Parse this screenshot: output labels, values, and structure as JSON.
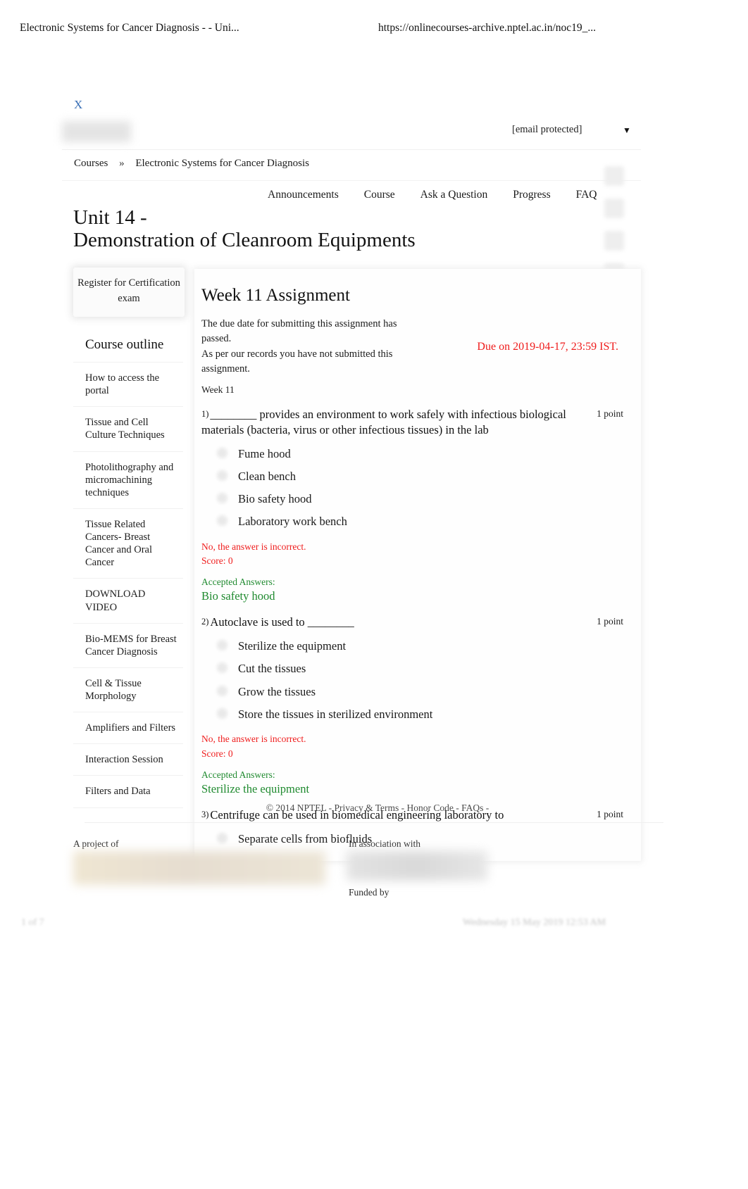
{
  "print_header": {
    "title": "Electronic Systems for Cancer Diagnosis - - Uni...",
    "url": "https://onlinecourses-archive.nptel.ac.in/noc19_..."
  },
  "print_footer": {
    "left": "1 of 7",
    "right": "Wednesday 15 May 2019 12:53 AM"
  },
  "topbar": {
    "close_label": "X",
    "account_email": "[email protected]",
    "account_caret": "▼"
  },
  "breadcrumb": {
    "root": "Courses",
    "separator": "»",
    "current": "Electronic Systems for Cancer Diagnosis"
  },
  "nav": {
    "tabs": [
      {
        "label": "Announcements"
      },
      {
        "label": "Course"
      },
      {
        "label": "Ask a Question"
      },
      {
        "label": "Progress"
      },
      {
        "label": "FAQ"
      }
    ]
  },
  "unit": {
    "title": "Unit 14 -\nDemonstration of Cleanroom Equipments"
  },
  "sidebar": {
    "register_button": "Register for Certification exam",
    "outline_heading": "Course outline",
    "items": [
      {
        "label": "How to access the portal"
      },
      {
        "label": "Tissue and Cell Culture Techniques"
      },
      {
        "label": "Photolithography and micromachining techniques"
      },
      {
        "label": "Tissue Related Cancers- Breast Cancer and Oral Cancer"
      },
      {
        "label": "DOWNLOAD VIDEO"
      },
      {
        "label": "Bio-MEMS for Breast Cancer Diagnosis"
      },
      {
        "label": "Cell & Tissue Morphology"
      },
      {
        "label": "Amplifiers and Filters"
      },
      {
        "label": "Interaction Session"
      },
      {
        "label": "Filters and Data"
      }
    ]
  },
  "assignment": {
    "title": "Week 11 Assignment",
    "due_note_line1": "The due date for submitting this assignment has passed.",
    "due_note_line2": "As per our records you have not submitted this assignment.",
    "due_date": "Due on 2019-04-17, 23:59 IST.",
    "week_label": "Week 11",
    "accepted_answers_label": "Accepted Answers:",
    "incorrect_text": "No, the answer is incorrect.",
    "score_text": "Score: 0",
    "questions": [
      {
        "number": "1)",
        "text": "________ provides an environment to work safely with infectious biological materials (bacteria, virus or other infectious tissues) in the lab",
        "points": "1 point",
        "options": [
          "Fume hood",
          "Clean bench",
          "Bio safety hood",
          "Laboratory work bench"
        ],
        "feedback": "No, the answer is incorrect.",
        "score": "Score: 0",
        "accepted_label": "Accepted Answers:",
        "accepted": "Bio safety hood"
      },
      {
        "number": "2)",
        "text": "Autoclave is used to ________",
        "points": "1 point",
        "options": [
          "Sterilize the equipment",
          "Cut the tissues",
          "Grow the tissues",
          "Store the tissues in sterilized environment"
        ],
        "feedback": "No, the answer is incorrect.",
        "score": "Score: 0",
        "accepted_label": "Accepted Answers:",
        "accepted": "Sterilize the equipment"
      },
      {
        "number": "3)",
        "text": "Centrifuge can be used in biomedical engineering laboratory to",
        "points": "1 point",
        "options": [
          "Separate cells from biofluids"
        ],
        "feedback": "",
        "score": "",
        "accepted_label": "",
        "accepted": ""
      }
    ]
  },
  "footer": {
    "links": "© 2014 NPTEL - Privacy & Terms - Honor Code - FAQs -",
    "project_of_label": "A project of",
    "association_label": "In association with",
    "funded_by_label": "Funded by"
  },
  "colors": {
    "error_red": "#ef1b1b",
    "accepted_green": "#1f8a2f",
    "link_blue": "#3a6fb5"
  }
}
